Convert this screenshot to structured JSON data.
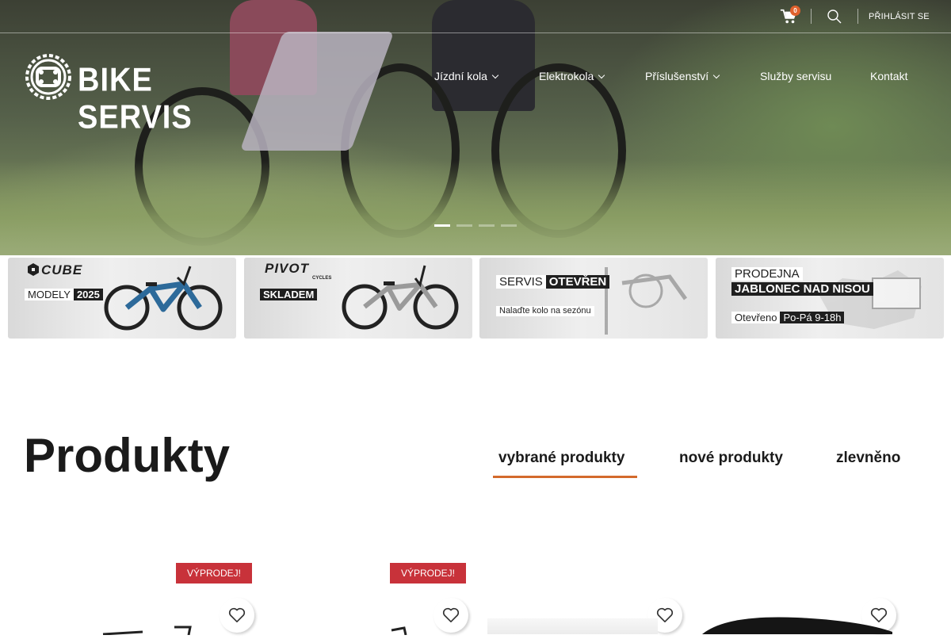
{
  "header": {
    "cart_count": "0",
    "login_label": "PŘIHLÁSIT SE",
    "logo_text": "BIKE SERVIS"
  },
  "nav": {
    "items": [
      {
        "label": "Jízdní kola",
        "has_dropdown": true
      },
      {
        "label": "Elektrokola",
        "has_dropdown": true
      },
      {
        "label": "Příslušenství",
        "has_dropdown": true
      },
      {
        "label": "Služby servisu",
        "has_dropdown": false
      },
      {
        "label": "Kontakt",
        "has_dropdown": false
      }
    ]
  },
  "hero": {
    "slide_count": 4,
    "active_slide": 1
  },
  "promo_cards": [
    {
      "brand": "CUBE",
      "label_light": "MODELY",
      "label_dark": "2025"
    },
    {
      "brand": "PIVOT",
      "brand_sub": "CYCLES",
      "label_dark": "SKLADEM"
    },
    {
      "title_light": "SERVIS",
      "title_dark": "OTEVŘEN",
      "subtitle": "Nalaďte kolo na sezónu"
    },
    {
      "title_light": "PRODEJNA",
      "title_dark": "JABLONEC NAD NISOU",
      "hours_light": "Otevřeno",
      "hours_dark": "Po-Pá 9-18h"
    }
  ],
  "products": {
    "heading": "Produkty",
    "tabs": [
      {
        "label": "vybrané produkty",
        "active": true
      },
      {
        "label": "nové produkty",
        "active": false
      },
      {
        "label": "zlevněno",
        "active": false
      }
    ],
    "sale_badge": "VÝPRODEJ!"
  },
  "colors": {
    "accent": "#d36a2c",
    "sale": "#c8323a",
    "badge": "#e0612d"
  }
}
